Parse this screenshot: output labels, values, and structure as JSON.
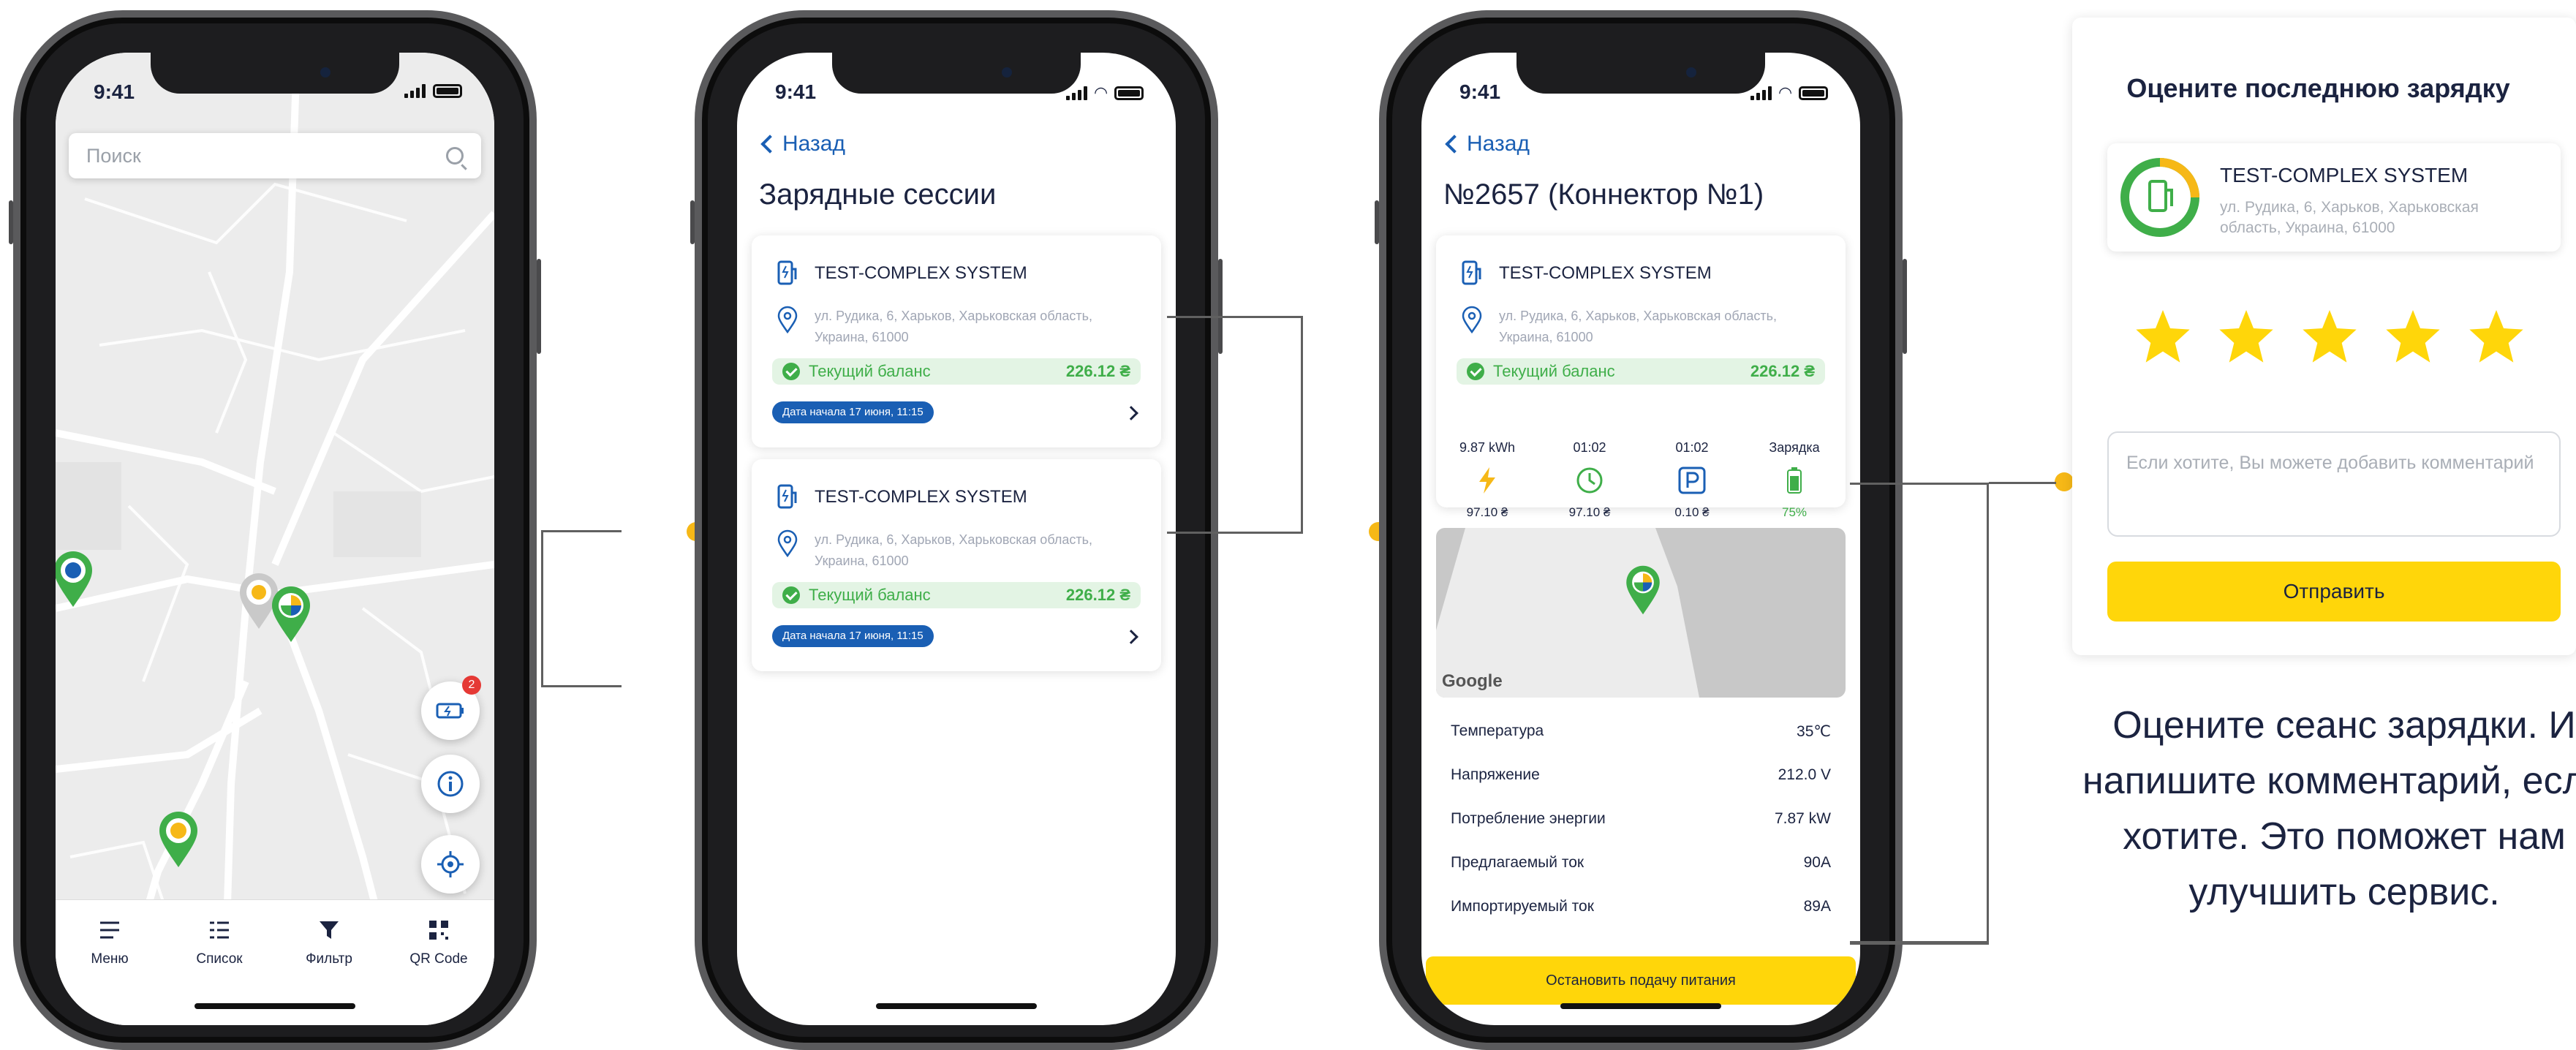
{
  "status_time": "9:41",
  "screen1": {
    "search_placeholder": "Поиск",
    "fab_badge": "2",
    "tabs": [
      {
        "label": "Меню",
        "icon": "menu-icon"
      },
      {
        "label": "Список",
        "icon": "list-icon"
      },
      {
        "label": "Фильтр",
        "icon": "filter-icon"
      },
      {
        "label": "QR Code",
        "icon": "qr-icon"
      }
    ]
  },
  "screen2": {
    "back": "Назад",
    "title": "Зарядные сессии",
    "sessions": [
      {
        "name": "TEST-COMPLEX SYSTEM",
        "address": "ул. Рудика, 6, Харьков, Харьковская область, Украина, 61000",
        "balance_label": "Текущий баланс",
        "balance": "226.12 ₴",
        "date": "Дата начала 17 июня, 11:15"
      },
      {
        "name": "TEST-COMPLEX SYSTEM",
        "address": "ул. Рудика, 6, Харьков, Харьковская область, Украина, 61000",
        "balance_label": "Текущий баланс",
        "balance": "226.12 ₴",
        "date": "Дата начала 17 июня, 11:15"
      }
    ]
  },
  "screen3": {
    "back": "Назад",
    "title": "№2657 (Коннектор №1)",
    "station": {
      "name": "TEST-COMPLEX SYSTEM",
      "address": "ул. Рудика, 6, Харьков, Харьковская область, Украина, 61000",
      "balance_label": "Текущий баланс",
      "balance": "226.12 ₴"
    },
    "metrics": [
      {
        "top": "9.87 kWh",
        "icon": "lightning-icon",
        "bottom": "97.10 ₴"
      },
      {
        "top": "01:02",
        "icon": "clock-icon",
        "bottom": "97.10 ₴"
      },
      {
        "top": "01:02",
        "icon": "parking-icon",
        "bottom": "0.10 ₴"
      },
      {
        "top": "Зарядка",
        "icon": "battery-icon",
        "bottom": "75%"
      }
    ],
    "map_label": "Google",
    "properties": [
      {
        "label": "Температура",
        "value": "35℃"
      },
      {
        "label": "Напряжение",
        "value": "212.0 V"
      },
      {
        "label": "Потребление энергии",
        "value": "7.87 kW"
      },
      {
        "label": "Предлагаемый ток",
        "value": "90A"
      },
      {
        "label": "Импортируемый ток",
        "value": "89A"
      }
    ],
    "stop_button": "Остановить подачу питания"
  },
  "rating": {
    "title": "Оцените последнюю зарядку",
    "station_name": "TEST-COMPLEX SYSTEM",
    "station_address": "ул. Рудика, 6, Харьков, Харьковская область, Украина, 61000",
    "stars": 5,
    "comment_placeholder": "Если хотите, Вы можете добавить комментарий",
    "send_button": "Отправить",
    "caption": "Оцените сеанс зарядки. И напишите комментарий, если хотите. Это поможет нам улучшить сервис."
  },
  "colors": {
    "accent_blue": "#1a5fb4",
    "yellow": "#ffd60a",
    "green": "#3fae49",
    "connector_dot": "#f6b817"
  }
}
